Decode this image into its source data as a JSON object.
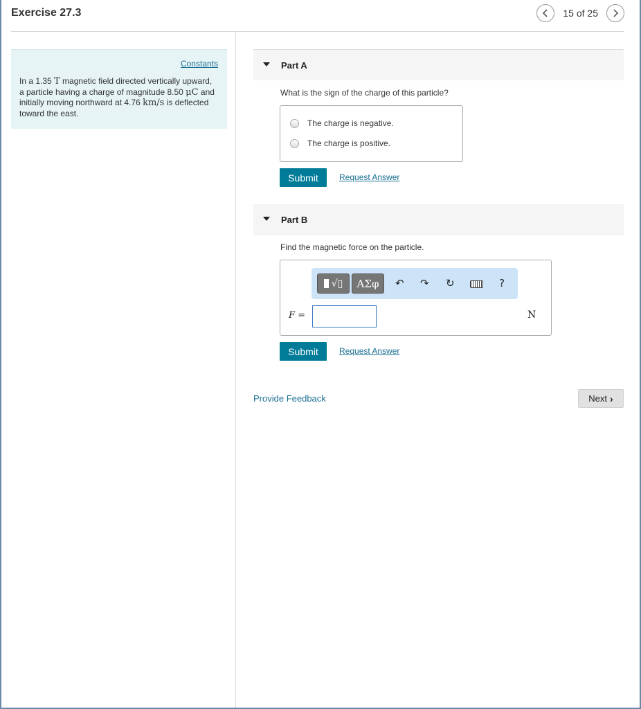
{
  "header": {
    "title": "Exercise 27.3",
    "page_count": "15 of 25",
    "prev_icon": "chevron-left-icon",
    "next_icon": "chevron-right-icon"
  },
  "info": {
    "constants_link": "Constants",
    "problem": {
      "p1": "In a 1.35 ",
      "unit_field": "T",
      "p2": " magnetic field directed vertically upward, a particle having a charge of magnitude 8.50 ",
      "unit_charge": "μC",
      "p3": " and initially moving northward at 4.76 ",
      "unit_speed": "km/s",
      "p4": " is deflected toward the east."
    }
  },
  "part_a": {
    "label": "Part A",
    "question": "What is the sign of the charge of this particle?",
    "options": [
      "The charge is negative.",
      "The charge is positive."
    ],
    "submit": "Submit",
    "request": "Request Answer"
  },
  "part_b": {
    "label": "Part B",
    "question": "Find the magnetic force on the particle.",
    "toolbar": {
      "greek": "ΑΣφ",
      "help": "?"
    },
    "variable": "F",
    "equals": " =",
    "unit": "N",
    "input_value": "",
    "submit": "Submit",
    "request": "Request Answer"
  },
  "footer": {
    "feedback": "Provide Feedback",
    "next": "Next"
  },
  "colors": {
    "accent": "#007c99",
    "link": "#1a6f92",
    "info_bg": "#e6f4f6",
    "toolbar_bg": "#cde4f8"
  }
}
